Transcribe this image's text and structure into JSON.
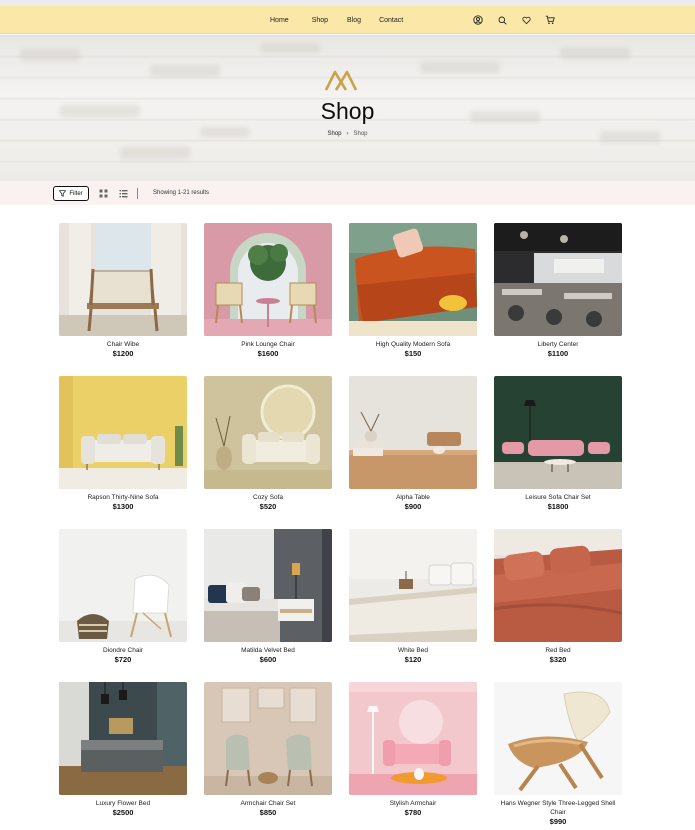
{
  "nav": {
    "links": [
      "Home",
      "Shop",
      "Blog",
      "Contact"
    ],
    "icons": [
      "user-icon",
      "search-icon",
      "heart-icon",
      "cart-icon"
    ]
  },
  "hero": {
    "title": "Shop",
    "breadcrumb": {
      "root": "Shop",
      "separator": "›",
      "current": "Shop"
    }
  },
  "toolbar": {
    "filter_label": "Filter",
    "results_text": "Showing 1-21 results"
  },
  "products": [
    {
      "name": "Chair Wibe",
      "price": "$1200"
    },
    {
      "name": "Pink Lounge Chair",
      "price": "$1600"
    },
    {
      "name": "High Quality Modern Sofa",
      "price": "$150"
    },
    {
      "name": "Liberty Center",
      "price": "$1100"
    },
    {
      "name": "Rapson Thirty-Nine Sofa",
      "price": "$1300"
    },
    {
      "name": "Cozy Sofa",
      "price": "$520"
    },
    {
      "name": "Alpha Table",
      "price": "$900"
    },
    {
      "name": "Leisure Sofa Chair Set",
      "price": "$1800"
    },
    {
      "name": "Diondre Chair",
      "price": "$720"
    },
    {
      "name": "Matilda Velvet Bed",
      "price": "$600"
    },
    {
      "name": "White Bed",
      "price": "$120"
    },
    {
      "name": "Red Bed",
      "price": "$320"
    },
    {
      "name": "Luxury Flower Bed",
      "price": "$2500"
    },
    {
      "name": "Armchair Chair Set",
      "price": "$850"
    },
    {
      "name": "Stylish Armchair",
      "price": "$780"
    },
    {
      "name": "Hans Wegner Style Three-Legged Shell Chair",
      "price": "$990"
    }
  ],
  "colors": {
    "nav_bg": "#fbe7a8",
    "filterbar_bg": "#faf2f0",
    "logo_gold": "#c9a24a"
  }
}
